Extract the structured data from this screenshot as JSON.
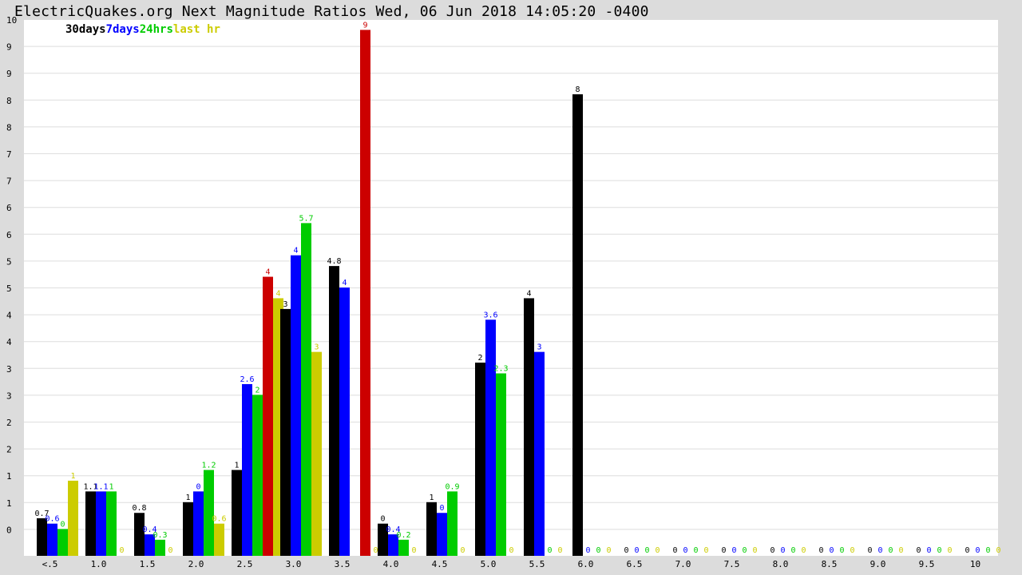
{
  "title": "ElectricQuakes.org Next Magnitude Ratios Wed, 06 Jun 2018 14:05:20 -0400",
  "chart_data": {
    "type": "bar",
    "categories": [
      "<.5",
      "1.0",
      "1.5",
      "2.0",
      "2.5",
      "3.0",
      "3.5",
      "4.0",
      "4.5",
      "5.0",
      "5.5",
      "6.0",
      "6.5",
      "7.0",
      "7.5",
      "8.0",
      "8.5",
      "9.0",
      "9.5",
      "10"
    ],
    "y_tick_labels": [
      "0",
      "1",
      "1",
      "2",
      "2",
      "3",
      "3",
      "4",
      "4",
      "5",
      "5",
      "6",
      "6",
      "7",
      "7",
      "8",
      "8",
      "9",
      "9",
      "10"
    ],
    "ylim": [
      0,
      10
    ],
    "grid": true,
    "legend_position": "top-left",
    "series": [
      {
        "name": "30days",
        "color": "#000000",
        "values": [
          0.7,
          1.2,
          0.8,
          1.0,
          1.6,
          4.6,
          5.4,
          0.6,
          1.0,
          3.6,
          4.8,
          8.6,
          0,
          0,
          0,
          0,
          0,
          0,
          0,
          0
        ],
        "labels": [
          "0.7",
          "1.1",
          "0.8",
          "1",
          "1",
          "3",
          "4.8",
          "0",
          "1",
          "2",
          "4",
          "8",
          "0",
          "0",
          "0",
          "0",
          "0",
          "0",
          "0",
          "0"
        ]
      },
      {
        "name": "7days",
        "color": "#0000ff",
        "values": [
          0.6,
          1.2,
          0.4,
          1.2,
          3.2,
          5.6,
          5.0,
          0.4,
          0.8,
          4.4,
          3.8,
          0,
          0,
          0,
          0,
          0,
          0,
          0,
          0,
          0
        ],
        "labels": [
          "0.6",
          "1.1",
          "0.4",
          "0",
          "2.6",
          "4",
          "4",
          "0.4",
          "0",
          "3.6",
          "3",
          "0",
          "0",
          "0",
          "0",
          "0",
          "0",
          "0",
          "0",
          "0"
        ]
      },
      {
        "name": "24hrs",
        "color": "#00cc00",
        "values": [
          0.5,
          1.2,
          0.3,
          1.6,
          3.0,
          6.2,
          0,
          0.3,
          1.2,
          3.4,
          0,
          0,
          0,
          0,
          0,
          0,
          0,
          0,
          0,
          0
        ],
        "labels": [
          "0",
          "1",
          "0.3",
          "1.2",
          "2",
          "5.7",
          "",
          "0.2",
          "0.9",
          "2.3",
          "0",
          "0",
          "0",
          "0",
          "0",
          "0",
          "0",
          "0",
          "0",
          "0"
        ]
      },
      {
        "name": "last hr",
        "color": "#cccc00",
        "values": [
          1.4,
          0,
          0,
          0.6,
          4.8,
          3.8,
          0,
          0,
          0,
          0,
          0,
          0,
          0,
          0,
          0,
          0,
          0,
          0,
          0,
          0
        ],
        "labels": [
          "1",
          "0",
          "0",
          "0.6",
          "4",
          "3",
          "0",
          "0",
          "0",
          "0",
          "0",
          "0",
          "0",
          "0",
          "0",
          "0",
          "0",
          "0",
          "0",
          "0"
        ]
      },
      {
        "name": "",
        "color": "#cc0000",
        "values": [
          0,
          0,
          0,
          0,
          5.2,
          0,
          9.8,
          0,
          0,
          0,
          0,
          0,
          0,
          0,
          0,
          0,
          0,
          0,
          0,
          0
        ],
        "labels": [
          "",
          "",
          "",
          "",
          "4",
          "",
          "9",
          "",
          "",
          "",
          "",
          "",
          "",
          "",
          "",
          "",
          "",
          "",
          "",
          ""
        ]
      }
    ]
  }
}
